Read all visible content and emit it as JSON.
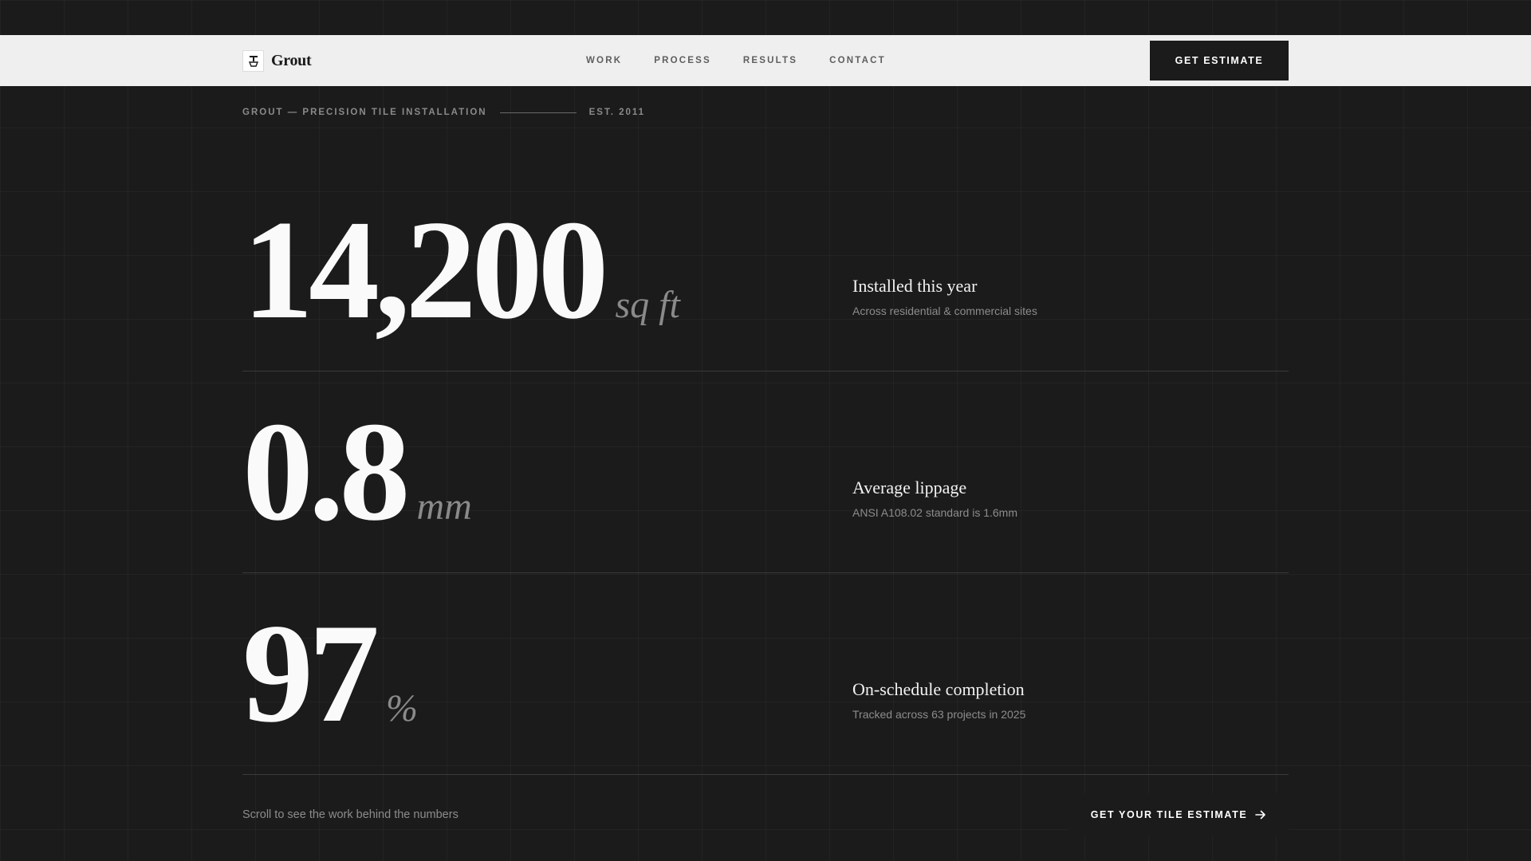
{
  "brand": {
    "name": "Grout",
    "logo_icon": "tile-trowel-icon"
  },
  "nav": {
    "items": [
      "WORK",
      "PROCESS",
      "RESULTS",
      "CONTACT"
    ],
    "cta_label": "GET ESTIMATE"
  },
  "tagline": {
    "left": "GROUT — PRECISION TILE INSTALLATION",
    "right": "EST. 2011"
  },
  "stats": [
    {
      "value": "14,200",
      "unit": "sq ft",
      "title": "Installed this year",
      "subtitle": "Across residential & commercial sites"
    },
    {
      "value": "0.8",
      "unit": "mm",
      "title": "Average lippage",
      "subtitle": "ANSI A108.02 standard is 1.6mm"
    },
    {
      "value": "97",
      "unit": "%",
      "title": "On-schedule completion",
      "subtitle": "Tracked across 63 projects in 2025"
    }
  ],
  "footer": {
    "scroll_hint": "Scroll to see the work behind the numbers",
    "cta_label": "GET YOUR TILE ESTIMATE",
    "cta_icon": "arrow-right-icon"
  },
  "colors": {
    "background": "#1b1b1b",
    "header_bg": "#efefef",
    "text_primary": "#fafafa",
    "text_muted": "#8a8a8a"
  }
}
